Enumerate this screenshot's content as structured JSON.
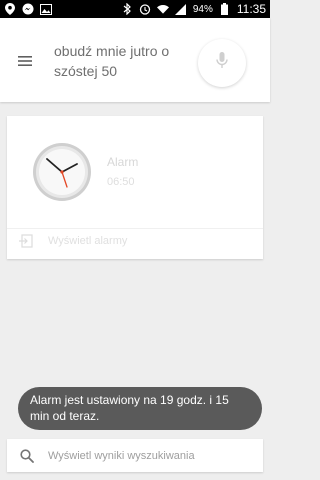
{
  "status_bar": {
    "battery": "94%",
    "time": "11:35",
    "left_icons": [
      "location-icon",
      "messenger-icon",
      "gallery-icon"
    ],
    "right_icons": [
      "bluetooth-icon",
      "alarm-icon",
      "wifi-icon",
      "signal-icon",
      "battery-icon"
    ]
  },
  "search_header": {
    "query": "obudź mnie jutro o szóstej 50",
    "menu_icon": "menu-icon",
    "mic_icon": "microphone-icon"
  },
  "alarm_card": {
    "title": "Alarm",
    "time": "06:50",
    "icon": "clock-icon",
    "action_label": "Wyświetl alarmy"
  },
  "toast": {
    "message": "Alarm jest ustawiony na 19 godz. i 15 min od teraz."
  },
  "bottom_search": {
    "label": "Wyświetl wyniki wyszukiwania",
    "icon": "search-icon"
  },
  "colors": {
    "background": "#eeeeee",
    "toast_bg": "#5a5a5a",
    "clock_hand_red": "#e34724",
    "mic_gray": "#cfcfcf"
  }
}
